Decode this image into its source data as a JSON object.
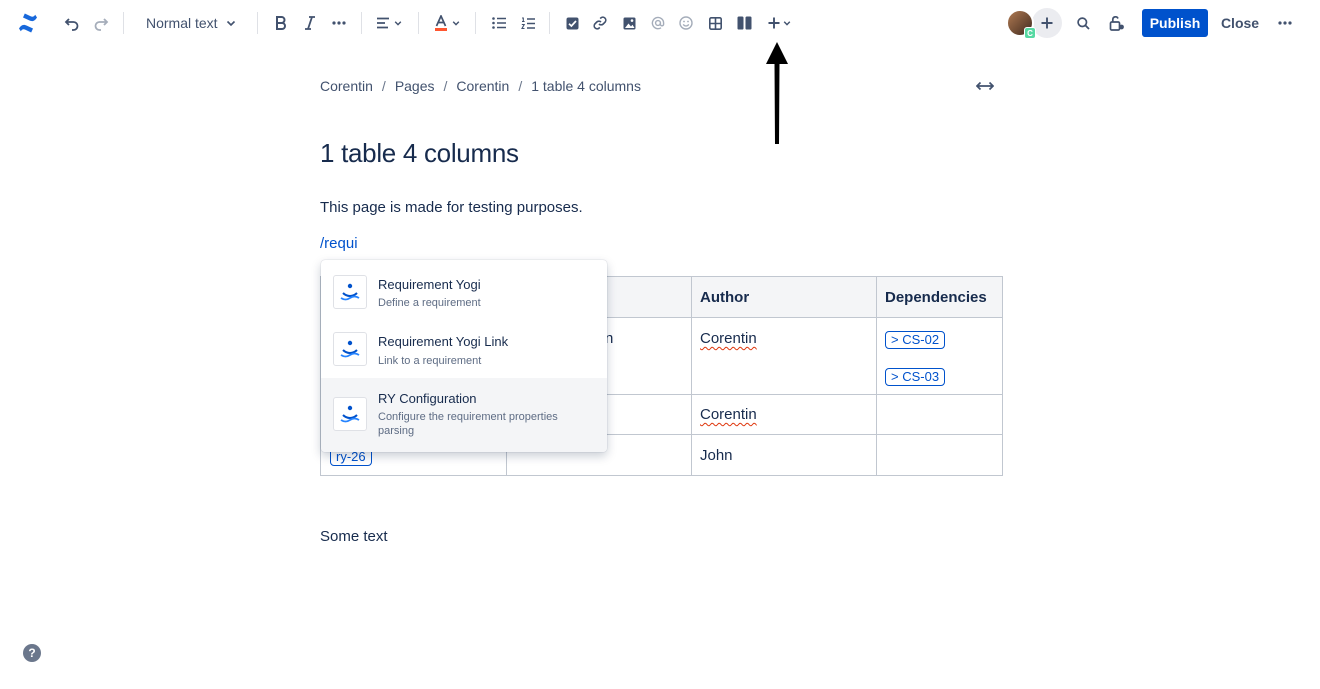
{
  "toolbar": {
    "text_style": "Normal text",
    "publish_label": "Publish",
    "close_label": "Close",
    "avatar_badge": "C"
  },
  "breadcrumb": [
    "Corentin",
    "Pages",
    "Corentin",
    "1 table 4 columns"
  ],
  "page": {
    "title": "1 table 4 columns",
    "paragraph": "This page is made for testing purposes.",
    "slash_query": "/requi",
    "footer_text": "Some text"
  },
  "table": {
    "headers": [
      "",
      "",
      "Author",
      "Dependencies"
    ],
    "rows": [
      {
        "c1": "",
        "c2": "n",
        "author": "Corentin",
        "deps": [
          "> CS-02",
          "> CS-03"
        ]
      },
      {
        "c1": "",
        "c2": "",
        "author": "Corentin",
        "deps": []
      },
      {
        "c1": "ry-26",
        "c2": "",
        "author": "John",
        "deps": []
      }
    ]
  },
  "insert_menu": {
    "items": [
      {
        "title": "Requirement Yogi",
        "description": "Define a requirement"
      },
      {
        "title": "Requirement Yogi Link",
        "description": "Link to a requirement"
      },
      {
        "title": "RY Configuration",
        "description": "Configure the requirement properties parsing"
      }
    ],
    "selected_index": 2
  },
  "help_label": "?",
  "colors": {
    "brand": "#1868db",
    "primary_button": "#0052cc",
    "link": "#0052cc",
    "text": "#172b4d"
  }
}
